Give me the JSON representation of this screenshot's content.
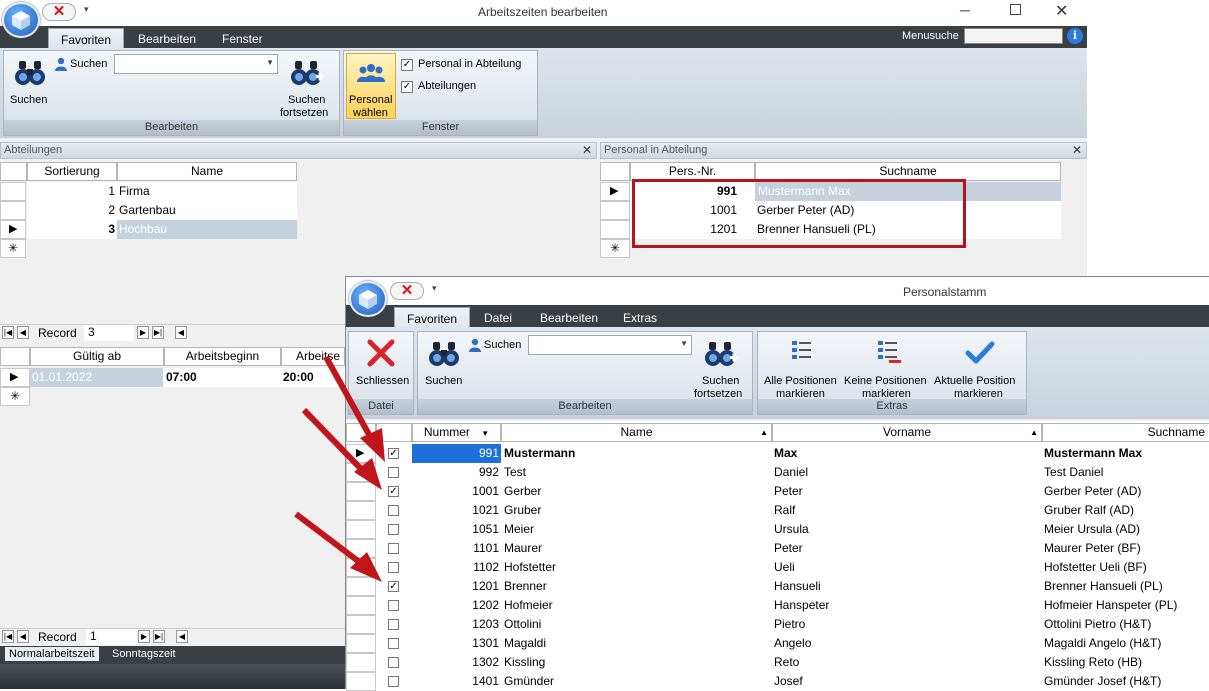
{
  "window1": {
    "title": "Arbeitszeiten bearbeiten",
    "tabs": [
      "Favoriten",
      "Bearbeiten",
      "Fenster"
    ],
    "menusuche_label": "Menusuche",
    "suchen_label": "Suchen",
    "suchen_small_label": "Suchen",
    "suchen_fortsetzen": [
      "Suchen",
      "fortsetzen"
    ],
    "group_bearbeiten": "Bearbeiten",
    "personal_waehlen": [
      "Personal",
      "wählen"
    ],
    "check_personal": "Personal in Abteilung",
    "check_abteilungen": "Abteilungen",
    "group_fenster": "Fenster"
  },
  "abteilungen": {
    "title": "Abteilungen",
    "headers": [
      "Sortierung",
      "Name"
    ],
    "rows": [
      {
        "sort": "1",
        "name": "Firma"
      },
      {
        "sort": "2",
        "name": "Gartenbau"
      },
      {
        "sort": "3",
        "name": "Hochbau"
      }
    ],
    "record_label": "Record",
    "record_value": "3"
  },
  "personal_abteilung": {
    "title": "Personal in Abteilung",
    "headers": [
      "Pers.-Nr.",
      "Suchname"
    ],
    "rows": [
      {
        "nr": "991",
        "name": "Mustermann Max"
      },
      {
        "nr": "1001",
        "name": "Gerber Peter (AD)"
      },
      {
        "nr": "1201",
        "name": "Brenner Hansueli (PL)"
      }
    ]
  },
  "arbeitszeiten": {
    "headers": [
      "Gültig ab",
      "Arbeitsbeginn",
      "Arbeitse"
    ],
    "row": {
      "gueltig": "01.01.2022",
      "beginn": "07:00",
      "ende": "20:00"
    },
    "record_label": "Record",
    "record_value": "1",
    "tabs": [
      "Normalarbeitszeit",
      "Sonntagszeit"
    ]
  },
  "window2": {
    "title": "Personalstamm",
    "tabs": [
      "Favoriten",
      "Datei",
      "Bearbeiten",
      "Extras"
    ],
    "schliessen": "Schliessen",
    "group_datei": "Datei",
    "suchen_label": "Suchen",
    "suchen_small_label": "Suchen",
    "suchen_fortsetzen": [
      "Suchen",
      "fortsetzen"
    ],
    "group_bearbeiten": "Bearbeiten",
    "alle_positionen": [
      "Alle Positionen",
      "markieren"
    ],
    "keine_positionen": [
      "Keine Positionen",
      "markieren"
    ],
    "aktuelle_position": [
      "Aktuelle Position",
      "markieren"
    ],
    "group_extras": "Extras",
    "headers": [
      "Nummer",
      "Name",
      "Vorname",
      "Suchname"
    ],
    "rows": [
      {
        "checked": true,
        "nr": "991",
        "name": "Mustermann",
        "vorname": "Max",
        "suchname": "Mustermann Max"
      },
      {
        "checked": false,
        "nr": "992",
        "name": "Test",
        "vorname": "Daniel",
        "suchname": "Test Daniel"
      },
      {
        "checked": true,
        "nr": "1001",
        "name": "Gerber",
        "vorname": "Peter",
        "suchname": "Gerber Peter (AD)"
      },
      {
        "checked": false,
        "nr": "1021",
        "name": "Gruber",
        "vorname": "Ralf",
        "suchname": "Gruber Ralf (AD)"
      },
      {
        "checked": false,
        "nr": "1051",
        "name": "Meier",
        "vorname": "Ursula",
        "suchname": "Meier Ursula (AD)"
      },
      {
        "checked": false,
        "nr": "1101",
        "name": "Maurer",
        "vorname": "Peter",
        "suchname": "Maurer Peter (BF)"
      },
      {
        "checked": false,
        "nr": "1102",
        "name": "Hofstetter",
        "vorname": "Ueli",
        "suchname": "Hofstetter Ueli (BF)"
      },
      {
        "checked": true,
        "nr": "1201",
        "name": "Brenner",
        "vorname": "Hansueli",
        "suchname": "Brenner Hansueli (PL)"
      },
      {
        "checked": false,
        "nr": "1202",
        "name": "Hofmeier",
        "vorname": "Hanspeter",
        "suchname": "Hofmeier Hanspeter (PL)"
      },
      {
        "checked": false,
        "nr": "1203",
        "name": "Ottolini",
        "vorname": "Pietro",
        "suchname": "Ottolini Pietro (H&T)"
      },
      {
        "checked": false,
        "nr": "1301",
        "name": "Magaldi",
        "vorname": "Angelo",
        "suchname": "Magaldi Angelo (H&T)"
      },
      {
        "checked": false,
        "nr": "1302",
        "name": "Kissling",
        "vorname": "Reto",
        "suchname": "Kissling Reto (HB)"
      },
      {
        "checked": false,
        "nr": "1401",
        "name": "Gmünder",
        "vorname": "Josef",
        "suchname": "Gmünder Josef (H&T)"
      }
    ]
  },
  "colors": {
    "ribbon_dark": "#3a3f44",
    "selection": "#c5d2de",
    "selection_blue": "#1e6fd9",
    "annotation_red": "#c0161b"
  }
}
